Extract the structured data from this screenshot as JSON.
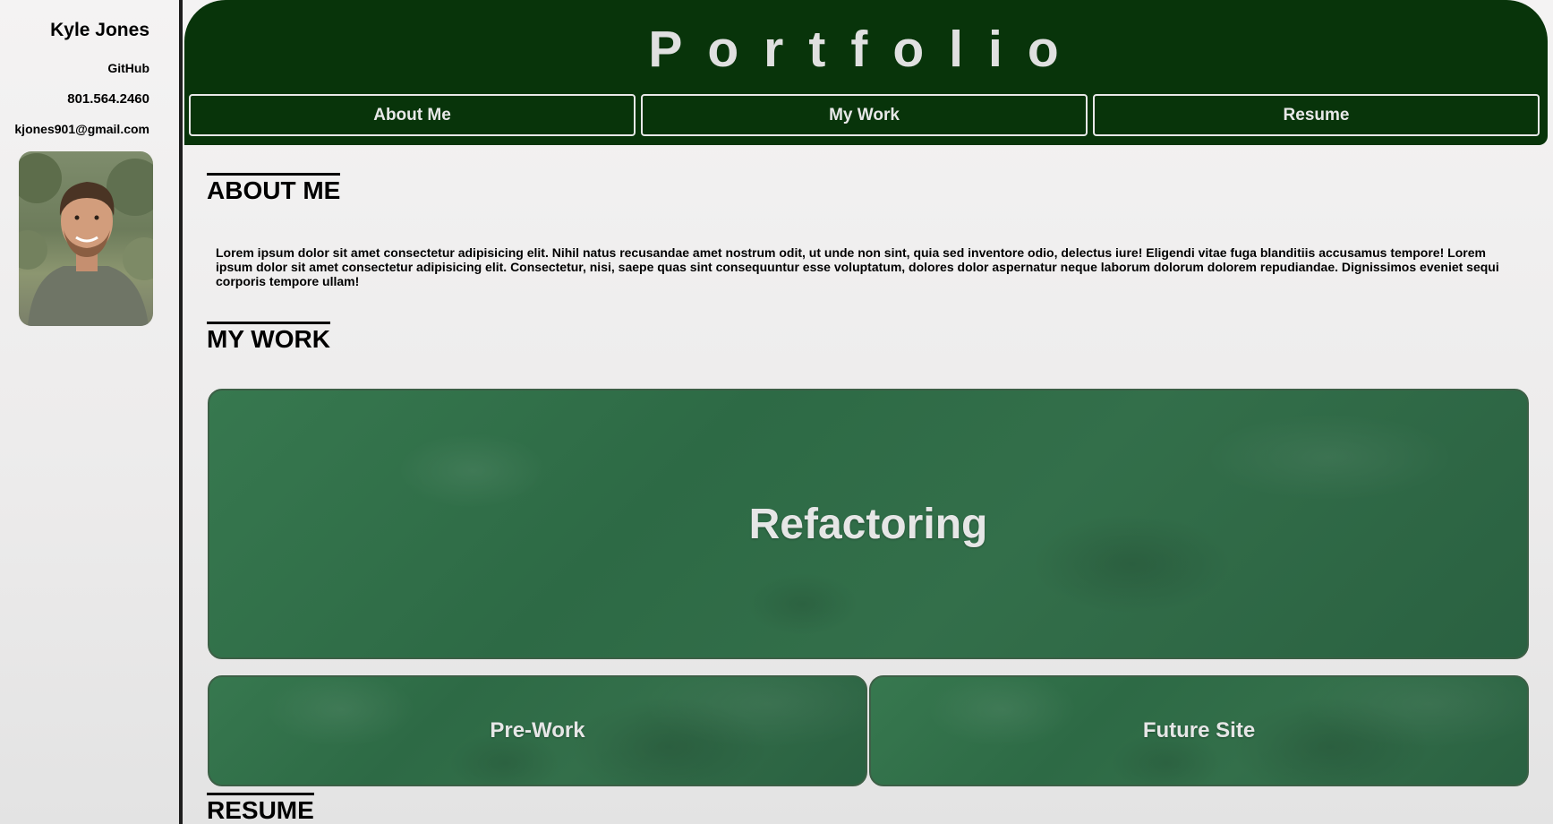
{
  "sidebar": {
    "name": "Kyle Jones",
    "github_label": "GitHub",
    "phone": "801.564.2460",
    "email": "kjones901@gmail.com"
  },
  "header": {
    "title": "Portfolio",
    "nav": [
      {
        "label": "About Me"
      },
      {
        "label": "My Work"
      },
      {
        "label": "Resume"
      }
    ]
  },
  "about": {
    "heading": "ABOUT ME",
    "text": "Lorem ipsum dolor sit amet consectetur adipisicing elit. Nihil natus recusandae amet nostrum odit, ut unde non sint, quia sed inventore odio, delectus iure! Eligendi vitae fuga blanditiis accusamus tempore! Lorem ipsum dolor sit amet consectetur adipisicing elit. Consectetur, nisi, saepe quas sint consequuntur esse voluptatum, dolores dolor aspernatur neque laborum dolorum dolorem repudiandae. Dignissimos eveniet sequi corporis tempore ullam!"
  },
  "work": {
    "heading": "MY WORK",
    "projects": [
      {
        "label": "Refactoring"
      },
      {
        "label": "Pre-Work"
      },
      {
        "label": "Future Site"
      }
    ]
  },
  "resume": {
    "heading": "RESUME"
  },
  "colors": {
    "header_bg": "#08340a",
    "card_green": "#2d6a45",
    "light_text": "#e0e0e0"
  }
}
